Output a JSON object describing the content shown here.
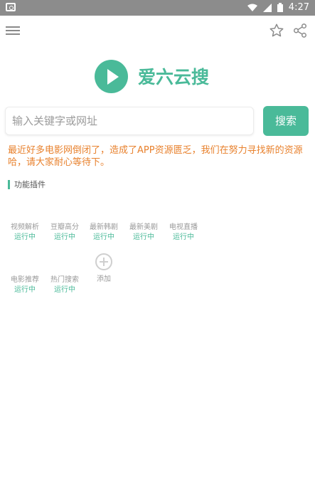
{
  "status_bar": {
    "time": "4:27"
  },
  "app": {
    "name": "爱六云搜"
  },
  "search": {
    "placeholder": "输入关键字或网址",
    "button_label": "搜索"
  },
  "notice": "最近好多电影网倒闭了，造成了APP资源匮乏，我们在努力寻找新的资源哈，请大家耐心等待下。",
  "section": {
    "title": "功能插件"
  },
  "plugins": [
    {
      "name": "视频解析",
      "status": "运行中"
    },
    {
      "name": "豆瓣高分",
      "status": "运行中"
    },
    {
      "name": "最新韩剧",
      "status": "运行中"
    },
    {
      "name": "最新美剧",
      "status": "运行中"
    },
    {
      "name": "电视直播",
      "status": "运行中"
    },
    {
      "name": "电影推荐",
      "status": "运行中"
    },
    {
      "name": "热门搜索",
      "status": "运行中"
    }
  ],
  "add_plugin": {
    "label": "添加"
  },
  "colors": {
    "accent": "#4aba99",
    "notice": "#e8812d",
    "status_bar": "#8c8c8c"
  }
}
